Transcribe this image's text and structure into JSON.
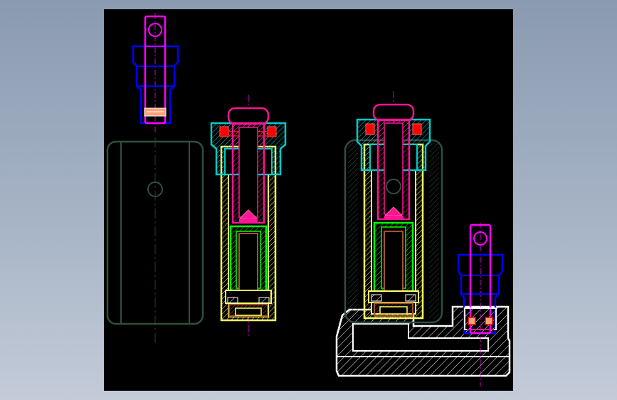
{
  "viewport": {
    "background": "#000000"
  },
  "colors": {
    "magenta": "#ff00ff",
    "pink": "#ff1493",
    "blue": "#0000ff",
    "cyan": "#00cccc",
    "yellow": "#ffff66",
    "green": "#00ff00",
    "brown": "#a0522d",
    "red": "#ff0000",
    "white": "#ffffff",
    "dark_green": "#2f4f3f",
    "salmon": "#ffa07a"
  },
  "parts": [
    "pin-top-left",
    "housing-left",
    "cylinder-middle",
    "assembly-right",
    "pin-bottom-right"
  ]
}
